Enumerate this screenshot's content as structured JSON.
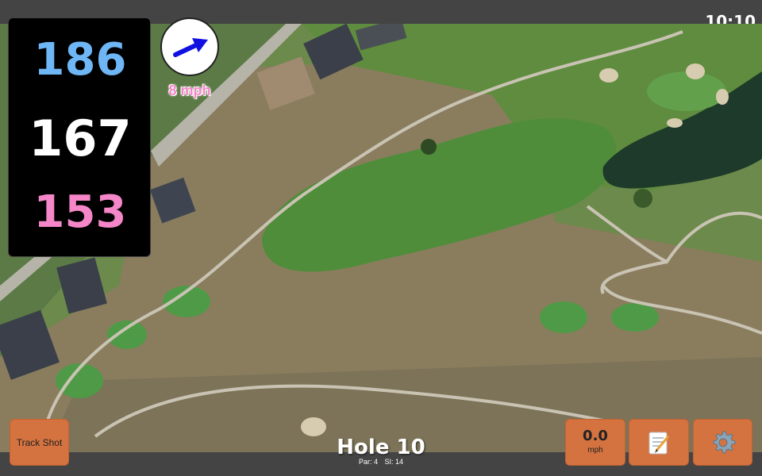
{
  "status_bar": {
    "time": "10:10"
  },
  "distances": {
    "back": "186",
    "middle": "167",
    "front": "153"
  },
  "wind": {
    "speed_label": "8 mph",
    "direction_icon": "wind-arrow-icon"
  },
  "hole": {
    "title": "Hole 10",
    "par_label": "Par: 4",
    "si_label": "SI: 14"
  },
  "buttons": {
    "track_shot_label": "Track Shot",
    "speed_value": "0.0",
    "speed_unit": "mph",
    "notes_icon": "notepad-icon",
    "settings_icon": "gear-icon"
  },
  "colors": {
    "back_distance": "#6fb6f7",
    "middle_distance": "#ffffff",
    "front_distance": "#f586c8",
    "button_bg": "#d4733f",
    "wind_arrow": "#1010e0"
  }
}
